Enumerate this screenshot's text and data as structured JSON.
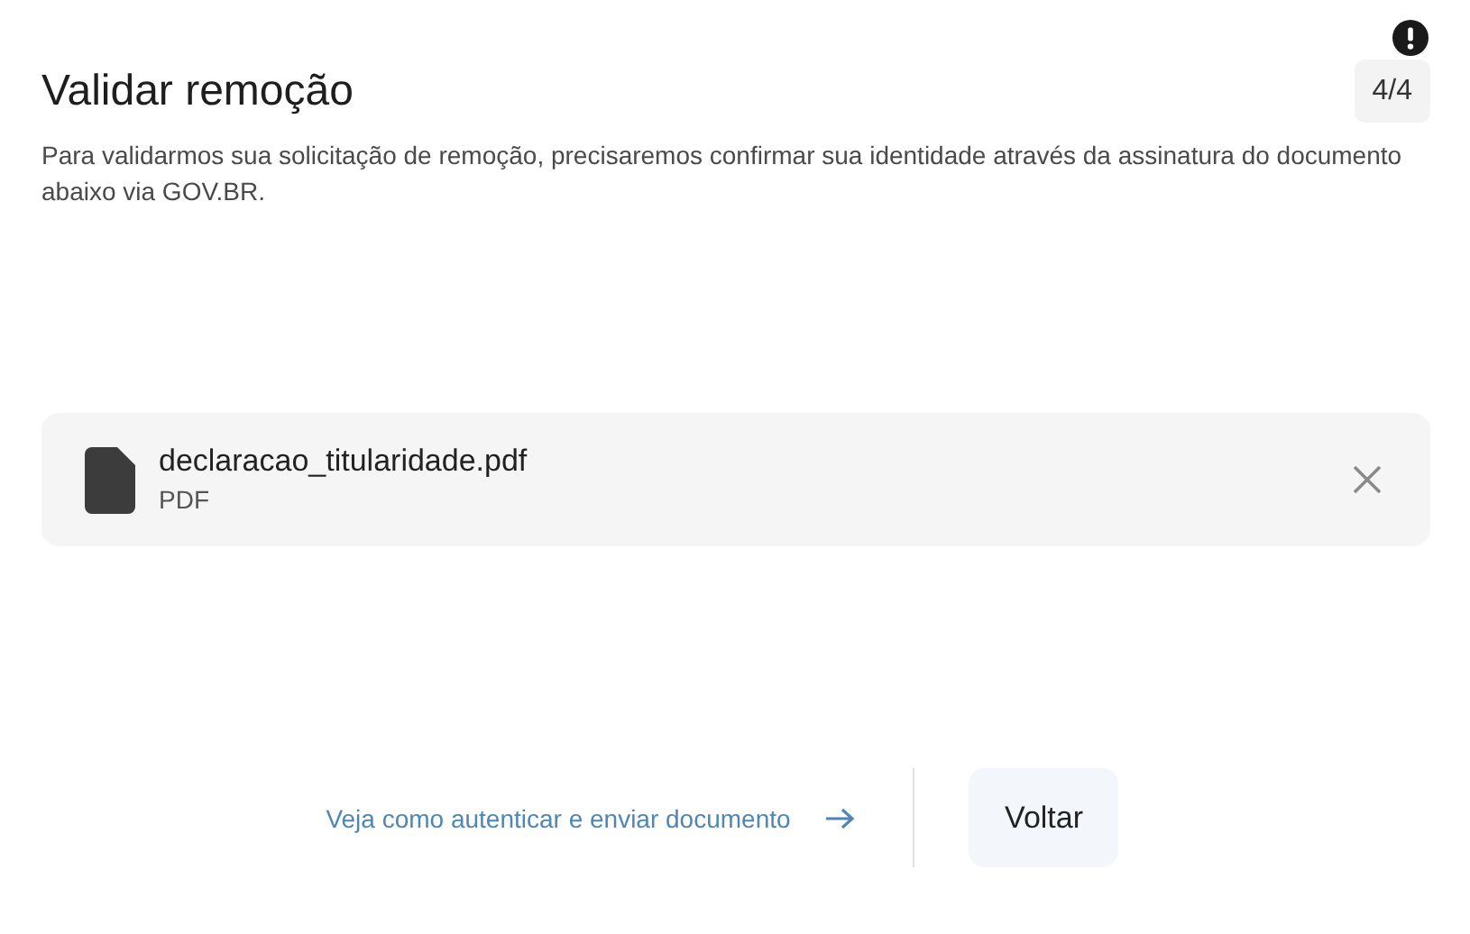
{
  "title": "Validar remoção",
  "step": "4/4",
  "description": "Para validarmos sua solicitação de remoção, precisaremos confirmar sua identidade através da assinatura do documento abaixo via GOV.BR.",
  "file": {
    "name": "declaracao_titularidade.pdf",
    "type": "PDF"
  },
  "footer": {
    "link": "Veja como autenticar e enviar documento",
    "button": "Voltar"
  }
}
